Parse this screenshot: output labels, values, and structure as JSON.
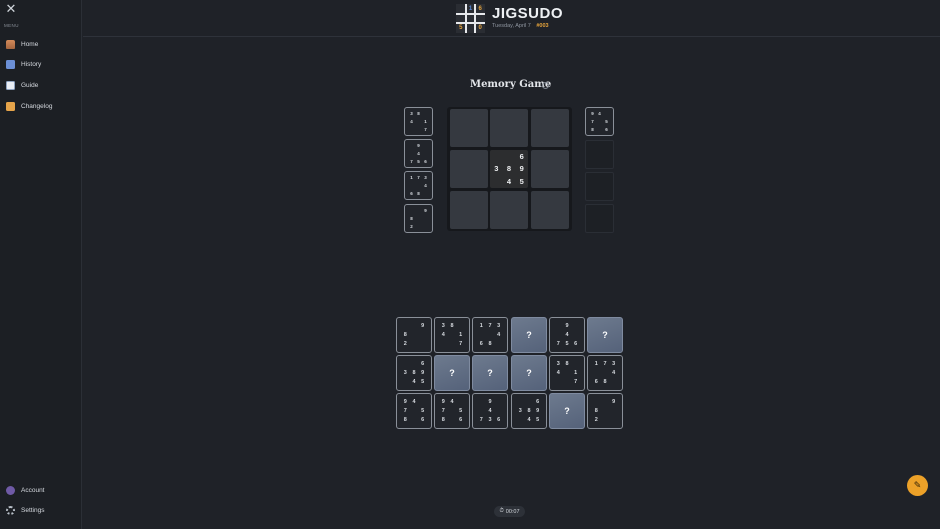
{
  "sidebar": {
    "close_icon": "close-icon",
    "menu_label": "MENU",
    "items": [
      {
        "label": "Home",
        "icon": "home-icon"
      },
      {
        "label": "History",
        "icon": "calendar-icon"
      },
      {
        "label": "Guide",
        "icon": "book-icon"
      },
      {
        "label": "Changelog",
        "icon": "scroll-icon"
      }
    ],
    "bottom_items": [
      {
        "label": "Account",
        "icon": "user-icon"
      },
      {
        "label": "Settings",
        "icon": "gear-icon"
      }
    ]
  },
  "header": {
    "title": "JIGSUDO",
    "date": "Tuesday, April 7",
    "puzzle_number": "#003",
    "logo_digits": [
      "1",
      "6",
      "5",
      "0"
    ]
  },
  "game": {
    "title": "Memory Game",
    "info_icon": "info-icon",
    "center_tile": [
      "",
      "",
      "6",
      "3",
      "8",
      "9",
      "",
      "4",
      "5"
    ],
    "left_tiles": [
      [
        "3",
        "8",
        "",
        "4",
        "",
        "1",
        "",
        "",
        "7"
      ],
      [
        "",
        "9",
        "",
        "",
        "4",
        "",
        "7",
        "5",
        "6"
      ],
      [
        "1",
        "7",
        "3",
        "",
        "",
        "4",
        "6",
        "8",
        ""
      ],
      [
        "",
        "",
        "9",
        "8",
        "",
        "",
        "2",
        "",
        ""
      ]
    ],
    "right_tiles": [
      [
        "9",
        "4",
        "",
        "7",
        "",
        "5",
        "8",
        "",
        "6"
      ]
    ],
    "bank": [
      [
        "",
        "",
        "9",
        "8",
        "",
        "",
        "2",
        "",
        ""
      ],
      [
        "3",
        "8",
        "",
        "4",
        "",
        "1",
        "",
        "",
        "7"
      ],
      [
        "1",
        "7",
        "3",
        "",
        "",
        "4",
        "6",
        "8",
        ""
      ],
      "?",
      [
        "",
        "9",
        "",
        "",
        "4",
        "",
        "7",
        "5",
        "6"
      ],
      "?",
      [
        "",
        "",
        "6",
        "3",
        "8",
        "9",
        "",
        "4",
        "5"
      ],
      "?",
      "?",
      "?",
      [
        "3",
        "8",
        "",
        "4",
        "",
        "1",
        "",
        "",
        "7"
      ],
      [
        "1",
        "7",
        "3",
        "",
        "",
        "4",
        "6",
        "8",
        ""
      ],
      [
        "9",
        "4",
        "",
        "7",
        "",
        "5",
        "8",
        "",
        "6"
      ],
      [
        "9",
        "4",
        "",
        "7",
        "",
        "5",
        "8",
        "",
        "6"
      ],
      [
        "",
        "9",
        "",
        "",
        "4",
        "",
        "7",
        "3",
        "6"
      ],
      [
        "",
        "",
        "6",
        "3",
        "8",
        "9",
        "",
        "4",
        "5"
      ],
      "?",
      [
        "",
        "",
        "9",
        "8",
        "",
        "",
        "2",
        "",
        ""
      ]
    ],
    "hidden_symbol": "?"
  },
  "timer": {
    "icon": "stopwatch-icon",
    "value": "00:07"
  },
  "fab": {
    "icon": "pencil-icon"
  },
  "colors": {
    "accent": "#eca128",
    "background": "#1f2228",
    "hidden_tile": "#5f6c82"
  }
}
